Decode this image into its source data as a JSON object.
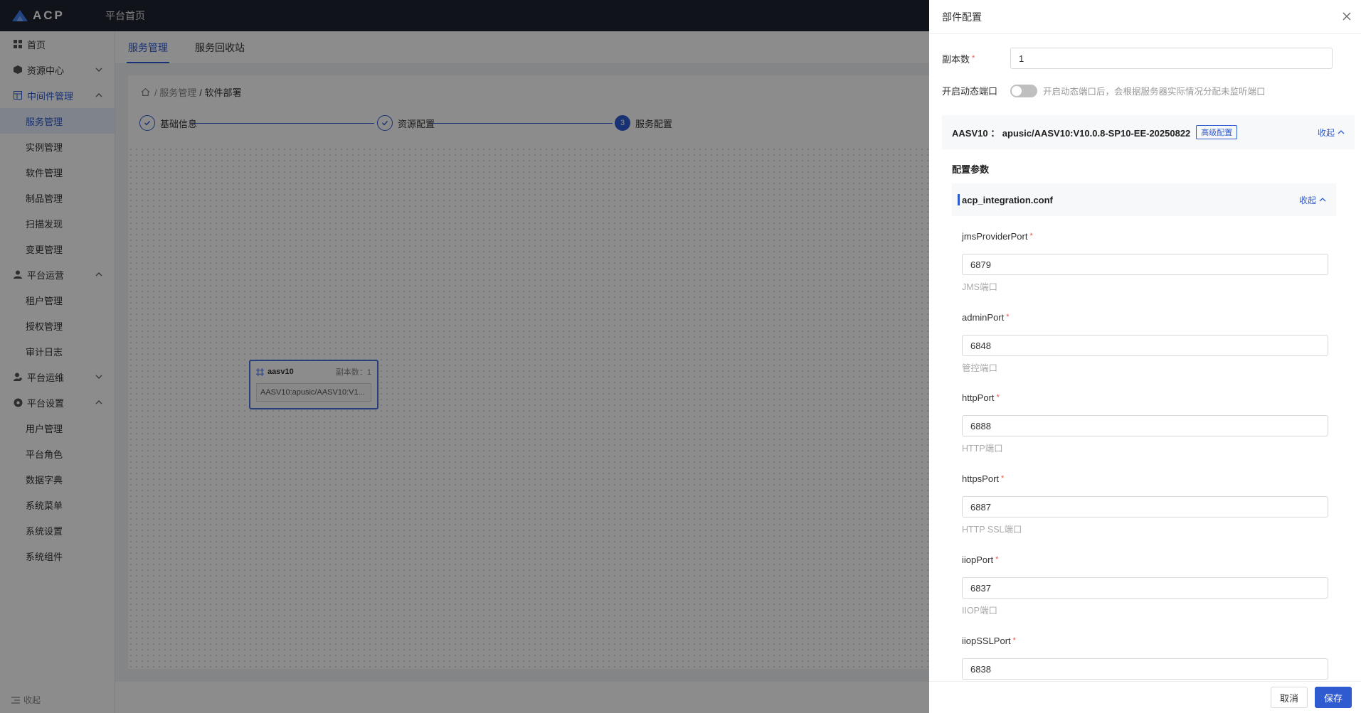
{
  "topbar": {
    "logo": "ACP",
    "title": "平台首页"
  },
  "sidebar": {
    "home": "首页",
    "resource_center": "资源中心",
    "middleware": "中间件管理",
    "middleware_items": [
      "服务管理",
      "实例管理",
      "软件管理",
      "制品管理",
      "扫描发现",
      "变更管理"
    ],
    "platform_ops": "平台运营",
    "ops_items": [
      "租户管理",
      "授权管理",
      "审计日志"
    ],
    "platform_maint": "平台运维",
    "platform_settings": "平台设置",
    "settings_items": [
      "用户管理",
      "平台角色",
      "数据字典",
      "系统菜单",
      "系统设置",
      "系统组件"
    ],
    "collapse": "收起"
  },
  "main": {
    "tabs": [
      "服务管理",
      "服务回收站"
    ],
    "breadcrumb": [
      "/ 服务管理",
      "/ 软件部署"
    ],
    "steps": [
      {
        "num": "",
        "label": "基础信息"
      },
      {
        "num": "",
        "label": "资源配置"
      },
      {
        "num": "3",
        "label": "服务配置"
      }
    ],
    "node": {
      "name": "aasv10",
      "replicas": "副本数：1",
      "artifact": "AASV10:apusic/AASV10:V1..."
    }
  },
  "drawer": {
    "title": "部件配置",
    "replicas_label": "副本数",
    "replicas_value": "1",
    "dyn_port_label": "开启动态端口",
    "dyn_port_hint": "开启动态端口后，会根据服务器实际情况分配未监听端口",
    "config_title": "AASV10 ： apusic/AASV10:V10.0.8-SP10-EE-20250822",
    "advanced_btn": "高级配置",
    "collapse": "收起",
    "params_title": "配置参数",
    "file_name": "acp_integration.conf",
    "fields": [
      {
        "label": "jmsProviderPort",
        "value": "6879",
        "desc": "JMS端口"
      },
      {
        "label": "adminPort",
        "value": "6848",
        "desc": "管控端口"
      },
      {
        "label": "httpPort",
        "value": "6888",
        "desc": "HTTP端口"
      },
      {
        "label": "httpsPort",
        "value": "6887",
        "desc": "HTTP SSL端口"
      },
      {
        "label": "iiopPort",
        "value": "6837",
        "desc": "IIOP端口"
      },
      {
        "label": "iiopSSLPort",
        "value": "6838",
        "desc": ""
      }
    ],
    "cancel": "取消",
    "save": "保存"
  },
  "colors": {
    "accent": "#2f5bd1",
    "topbar": "#1f2430"
  }
}
